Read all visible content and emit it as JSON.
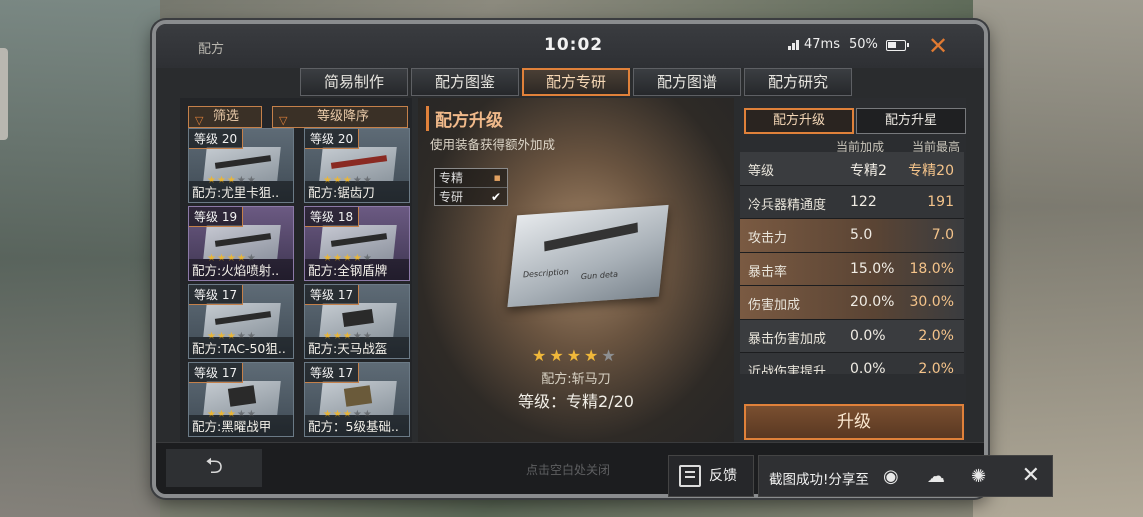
{
  "window": {
    "title": "配方",
    "clock": "10:02",
    "ping": "47ms",
    "battery": "50%"
  },
  "tabs": [
    {
      "label": "简易制作",
      "active": false
    },
    {
      "label": "配方图鉴",
      "active": false
    },
    {
      "label": "配方专研",
      "active": true
    },
    {
      "label": "配方图谱",
      "active": false
    },
    {
      "label": "配方研究",
      "active": false
    }
  ],
  "filters": {
    "filter_label": "筛选",
    "sort_label": "等级降序"
  },
  "recipes": [
    {
      "level": "等级 20",
      "name": "配方:尤里卡狙..",
      "stars": 3,
      "rarity": "blue"
    },
    {
      "level": "等级 20",
      "name": "配方:锯齿刀",
      "stars": 3,
      "rarity": "blue"
    },
    {
      "level": "等级 19",
      "name": "配方:火焰喷射..",
      "stars": 4,
      "rarity": "purple"
    },
    {
      "level": "等级 18",
      "name": "配方:全钢盾牌",
      "stars": 4,
      "rarity": "purple"
    },
    {
      "level": "等级 17",
      "name": "配方:TAC-50狙..",
      "stars": 3,
      "rarity": "blue"
    },
    {
      "level": "等级 17",
      "name": "配方:天马战盔",
      "stars": 3,
      "rarity": "blue"
    },
    {
      "level": "等级 17",
      "name": "配方:黑曜战甲",
      "stars": 3,
      "rarity": "blue"
    },
    {
      "level": "等级 17",
      "name": "配方：5级基础..",
      "stars": 3,
      "rarity": "blue"
    }
  ],
  "center": {
    "title": "配方升级",
    "subtitle": "使用装备获得额外加成",
    "modes": [
      "专精",
      "专研"
    ],
    "blueprint_label_1": "Description",
    "blueprint_label_2": "Gun deta",
    "stars_filled": 4,
    "stars_total": 5,
    "item_name": "配方:斩马刀",
    "item_level": "等级：专精2/20"
  },
  "right": {
    "tabs": [
      {
        "label": "配方升级",
        "active": true
      },
      {
        "label": "配方升星",
        "active": false
      }
    ],
    "col_current": "当前加成",
    "col_max": "当前最高",
    "stats": [
      {
        "key": "等级",
        "current": "专精2",
        "max": "专精20",
        "highlight": false
      },
      {
        "key": "冷兵器精通度",
        "current": "122",
        "max": "191",
        "highlight": false
      },
      {
        "key": "攻击力",
        "current": "5.0",
        "max": "7.0",
        "highlight": true
      },
      {
        "key": "暴击率",
        "current": "15.0%",
        "max": "18.0%",
        "highlight": true
      },
      {
        "key": "伤害加成",
        "current": "20.0%",
        "max": "30.0%",
        "highlight": true
      },
      {
        "key": "暴击伤害加成",
        "current": "0.0%",
        "max": "2.0%",
        "highlight": false
      },
      {
        "key": "近战伤害提升",
        "current": "0.0%",
        "max": "2.0%",
        "highlight": false
      }
    ],
    "upgrade_button": "升级"
  },
  "bottom": {
    "back_glyph": "⮌",
    "hint": "点击空白处关闭"
  },
  "share": {
    "feedback_label": "反馈",
    "share_text": "截图成功!分享至",
    "icons": [
      "weibo-icon",
      "wechat-icon",
      "moments-icon"
    ]
  },
  "colors": {
    "accent": "#e0813a",
    "star": "#f0b83a",
    "panel": "#2a2c2e"
  }
}
